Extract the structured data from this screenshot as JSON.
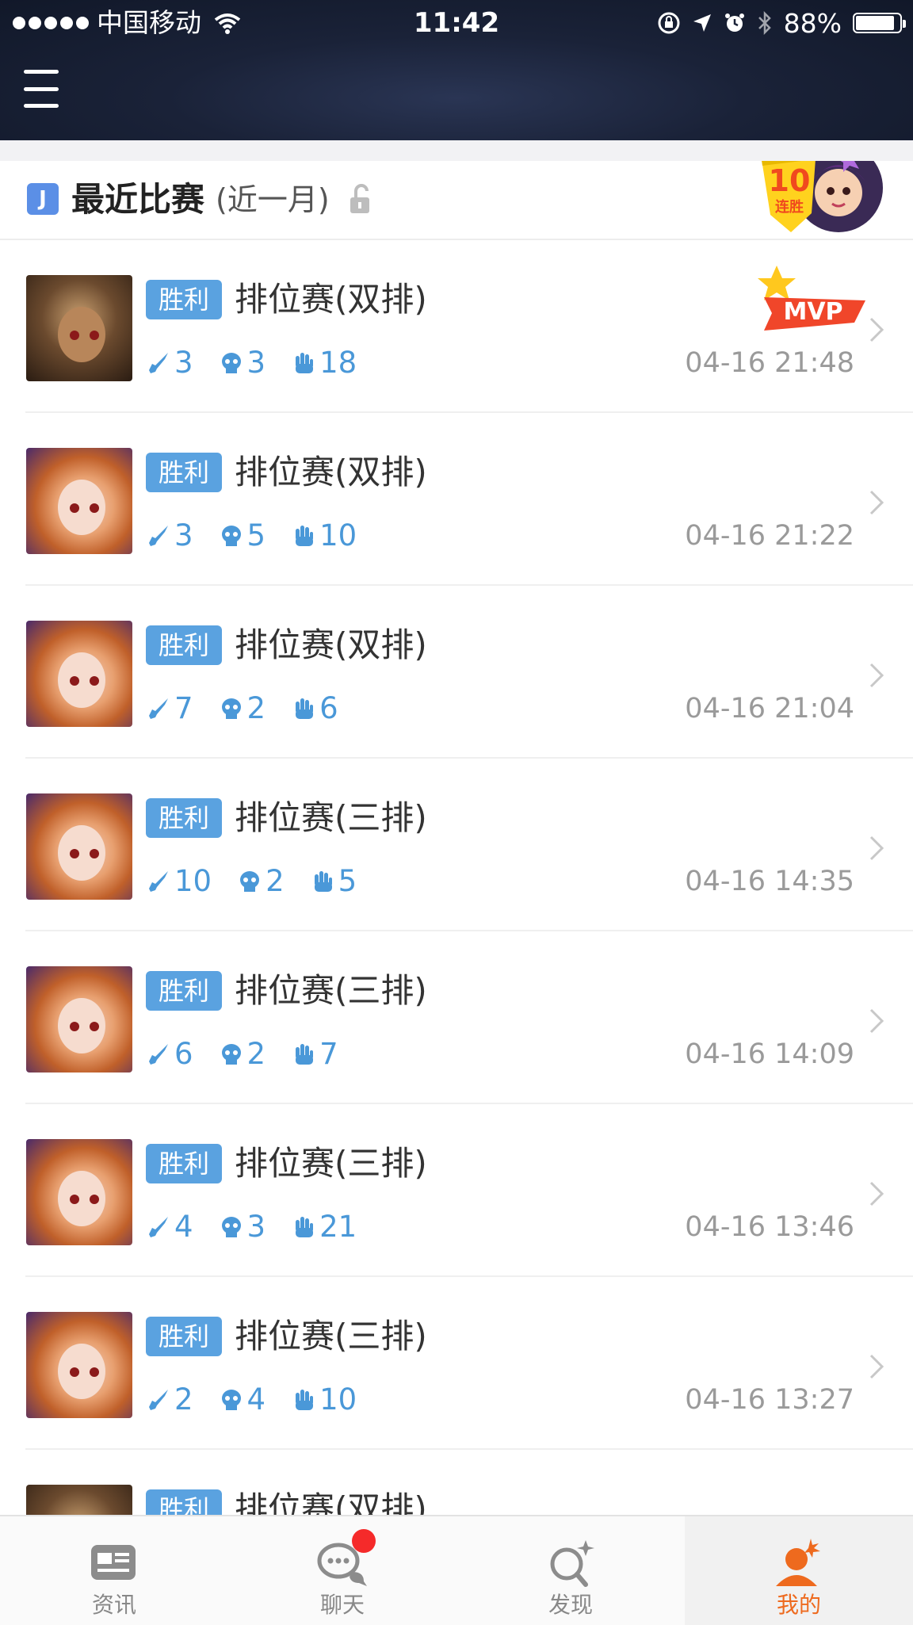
{
  "status_bar": {
    "carrier": "中国移动",
    "time": "11:42",
    "battery": "88%",
    "battery_level": 0.88
  },
  "section": {
    "title": "最近比赛",
    "subtitle": "(近一月)",
    "streak_number": "10",
    "streak_label": "连胜",
    "mvp_label": "MVP"
  },
  "matches": [
    {
      "avatar": "warrior",
      "result": "胜利",
      "mode": "排位赛(双排)",
      "kills": "3",
      "deaths": "3",
      "assists": "18",
      "time": "04-16 21:48",
      "mvp": true
    },
    {
      "avatar": "girl",
      "result": "胜利",
      "mode": "排位赛(双排)",
      "kills": "3",
      "deaths": "5",
      "assists": "10",
      "time": "04-16 21:22"
    },
    {
      "avatar": "girl",
      "result": "胜利",
      "mode": "排位赛(双排)",
      "kills": "7",
      "deaths": "2",
      "assists": "6",
      "time": "04-16 21:04"
    },
    {
      "avatar": "girl",
      "result": "胜利",
      "mode": "排位赛(三排)",
      "kills": "10",
      "deaths": "2",
      "assists": "5",
      "time": "04-16 14:35"
    },
    {
      "avatar": "girl",
      "result": "胜利",
      "mode": "排位赛(三排)",
      "kills": "6",
      "deaths": "2",
      "assists": "7",
      "time": "04-16 14:09"
    },
    {
      "avatar": "girl",
      "result": "胜利",
      "mode": "排位赛(三排)",
      "kills": "4",
      "deaths": "3",
      "assists": "21",
      "time": "04-16 13:46"
    },
    {
      "avatar": "girl",
      "result": "胜利",
      "mode": "排位赛(三排)",
      "kills": "2",
      "deaths": "4",
      "assists": "10",
      "time": "04-16 13:27"
    },
    {
      "avatar": "warrior",
      "result": "胜利",
      "mode": "排位赛(双排)",
      "kills": "",
      "deaths": "",
      "assists": "",
      "time": ""
    }
  ],
  "tabbar": {
    "tabs": [
      {
        "label": "资讯",
        "icon": "news-icon"
      },
      {
        "label": "聊天",
        "icon": "chat-icon",
        "has_notification": true
      },
      {
        "label": "发现",
        "icon": "discover-icon"
      },
      {
        "label": "我的",
        "icon": "profile-icon",
        "active": true
      }
    ]
  },
  "colors": {
    "accent": "#5aa2e0",
    "active_tab": "#ee6a1e",
    "notification": "#f52a2a",
    "header_bg": "#1a2238"
  }
}
